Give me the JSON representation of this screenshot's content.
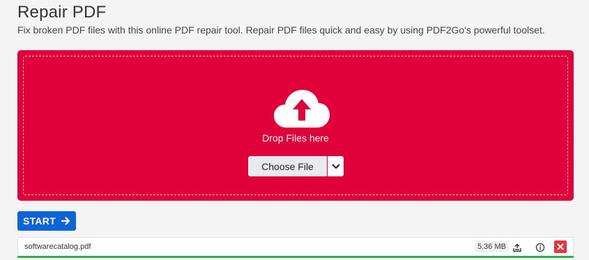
{
  "page": {
    "title": "Repair PDF",
    "subtitle": "Fix broken PDF files with this online PDF repair tool. Repair PDF files quick and easy by using PDF2Go's powerful toolset."
  },
  "dropzone": {
    "text": "Drop Files here",
    "upload_icon": "cloud-upload-icon",
    "choose_label": "Choose File",
    "toggle_icon": "chevron-down-icon",
    "accent_color": "#e0003a"
  },
  "start": {
    "label": "START",
    "icon": "arrow-right-icon",
    "color": "#0d63d8"
  },
  "file": {
    "name": "softwarecatalog.pdf",
    "size": "5.36 MB",
    "progress": 1.0,
    "progress_color": "#29b34a",
    "icons": [
      "compress-icon",
      "info-icon",
      "close-icon"
    ]
  }
}
